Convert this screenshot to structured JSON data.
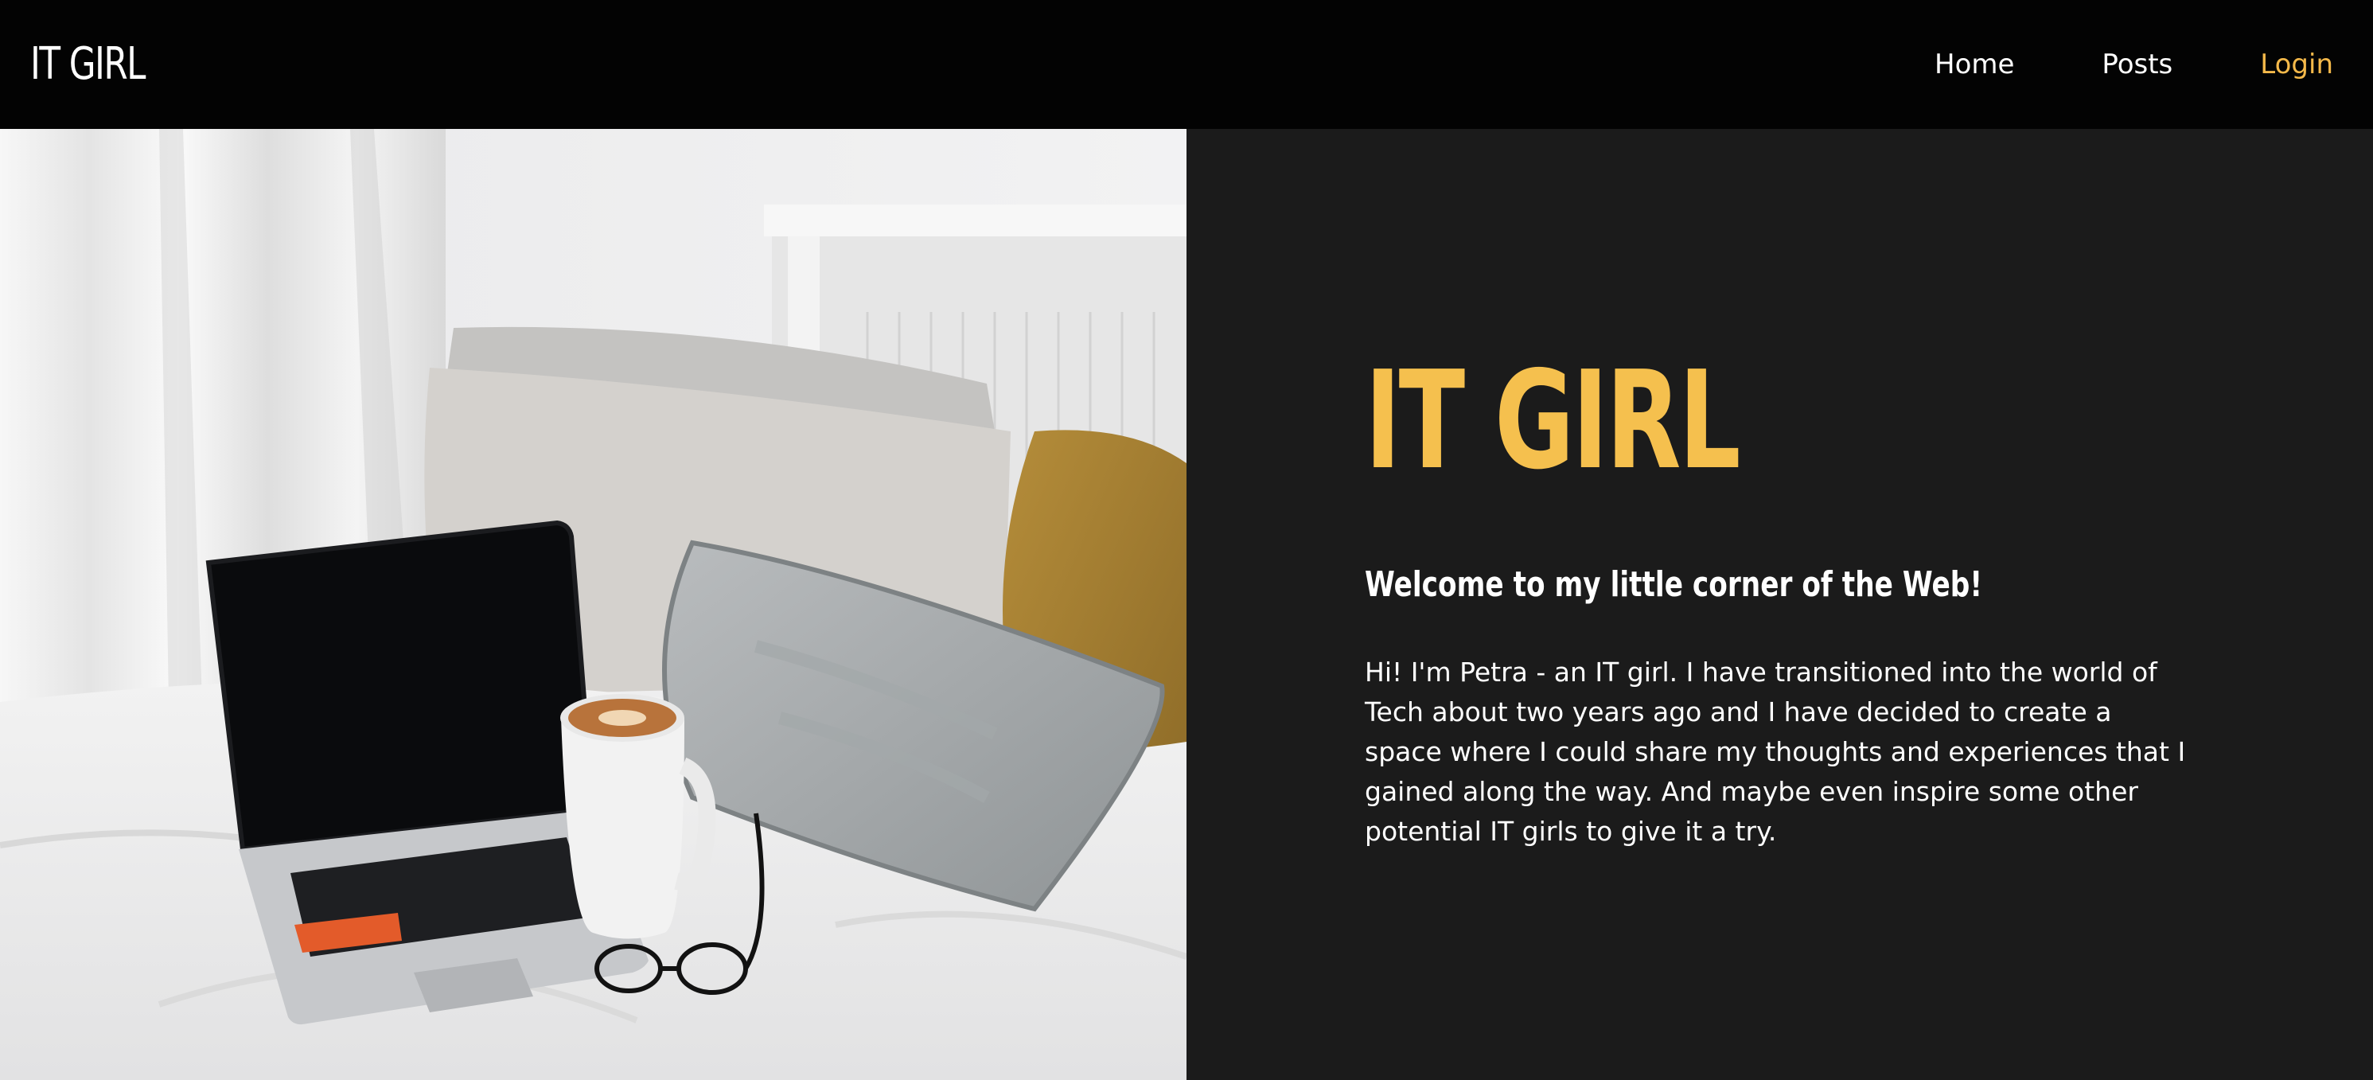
{
  "nav": {
    "brand": "IT GIRL",
    "links": [
      {
        "label": "Home"
      },
      {
        "label": "Posts"
      },
      {
        "label": "Login"
      }
    ]
  },
  "hero": {
    "title": "IT GIRL",
    "subtitle": "Welcome to my little corner of the Web!",
    "body": "Hi! I'm Petra - an IT girl. I have transitioned into the world of Tech about two years ago and I have decided to create a space where I could share my thoughts and experiences that I gained along the way. And maybe even inspire some other potential IT girls to give it a try."
  },
  "colors": {
    "navbar_background": "#030303",
    "panel_background": "#1b1b1b",
    "accent": "#f5c04e",
    "login_link": "#f5b94a",
    "text": "#ffffff"
  }
}
